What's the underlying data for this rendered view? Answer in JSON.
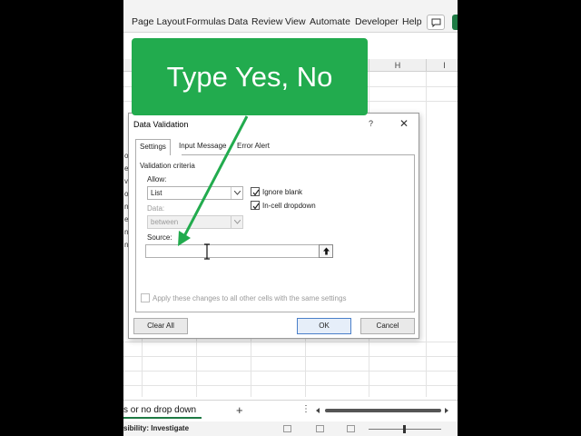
{
  "ribbon": {
    "tabs": [
      "Page Layout",
      "Formulas",
      "Data",
      "Review",
      "View",
      "Automate",
      "Developer",
      "Help"
    ]
  },
  "sheet": {
    "columns": [
      "H",
      "I"
    ]
  },
  "dialog": {
    "title": "Data Validation",
    "help": "?",
    "close": "✕",
    "tabs": [
      "Settings",
      "Input Message",
      "Error Alert"
    ],
    "criteria_label": "Validation criteria",
    "allow_label": "Allow:",
    "allow_value": "List",
    "data_label": "Data:",
    "data_value": "between",
    "ignore_blank": "Ignore blank",
    "in_cell_dropdown": "In-cell dropdown",
    "source_label": "Source:",
    "source_value": "",
    "apply_all": "Apply these changes to all other cells with the same settings",
    "clear_all": "Clear All",
    "ok": "OK",
    "cancel": "Cancel"
  },
  "callout": {
    "text": "Type Yes, No",
    "color": "#22ab4e"
  },
  "sheetbar": {
    "tab_name": "s or no drop down",
    "add": "+",
    "more": "⋮"
  },
  "status": {
    "text": "sibility: Investigate"
  }
}
